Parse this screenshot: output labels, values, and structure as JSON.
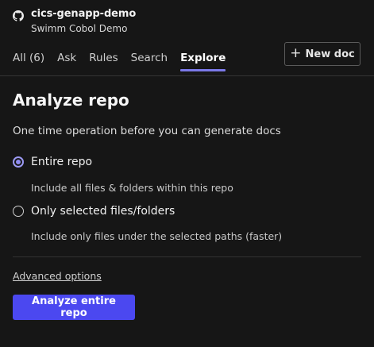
{
  "repo": {
    "name": "cics-genapp-demo",
    "subtitle": "Swimm Cobol Demo"
  },
  "tabs": [
    {
      "label": "All (6)",
      "active": false
    },
    {
      "label": "Ask",
      "active": false
    },
    {
      "label": "Rules",
      "active": false
    },
    {
      "label": "Search",
      "active": false
    },
    {
      "label": "Explore",
      "active": true
    }
  ],
  "new_doc": {
    "label": "New doc",
    "icon": "plus-icon"
  },
  "main": {
    "title": "Analyze repo",
    "subtitle": "One time operation before you can generate docs",
    "options": [
      {
        "label": "Entire repo",
        "hint": "Include all files & folders within this repo",
        "selected": true
      },
      {
        "label": "Only selected files/folders",
        "hint": "Include only files under the selected paths (faster)",
        "selected": false
      }
    ],
    "advanced_link": "Advanced options",
    "analyze_button": "Analyze entire repo"
  },
  "colors": {
    "background": "#161616",
    "accent": "#4b48f0",
    "tab_underline": "#7b79e8"
  }
}
